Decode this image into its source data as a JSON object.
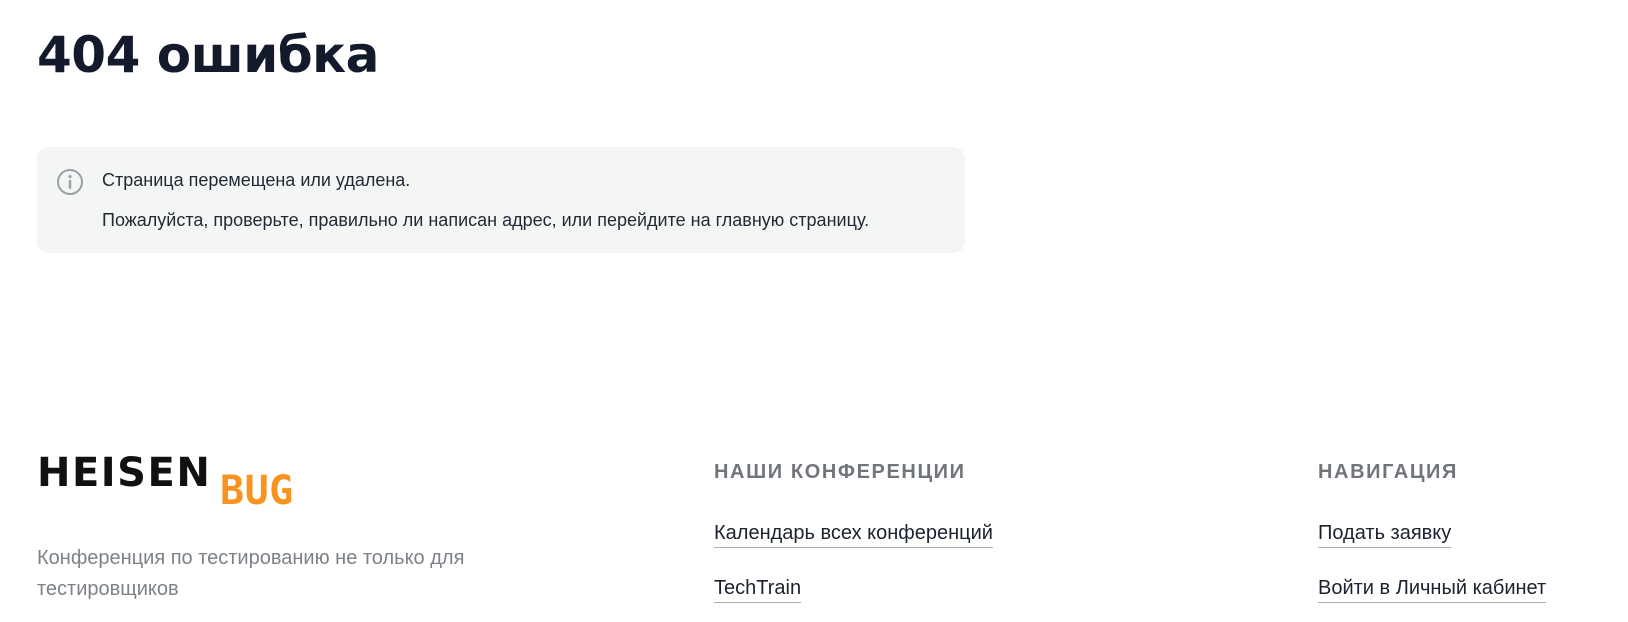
{
  "page": {
    "title": "404 ошибка"
  },
  "notice": {
    "icon": "info-icon",
    "line1": "Страница перемещена или удалена.",
    "line2": "Пожалуйста, проверьте, правильно ли написан адрес, или перейдите на главную страницу."
  },
  "footer": {
    "logo": {
      "text_primary": "HEISEN",
      "text_accent": "BUG",
      "primary_color": "#111111",
      "accent_color": "#f7931e"
    },
    "tagline": "Конференция по тестированию не только для тестировщиков",
    "conferences": {
      "heading": "НАШИ КОНФЕРЕНЦИИ",
      "links": [
        {
          "label": "Календарь всех конференций"
        },
        {
          "label": "TechTrain"
        }
      ]
    },
    "navigation": {
      "heading": "НАВИГАЦИЯ",
      "links": [
        {
          "label": "Подать заявку"
        },
        {
          "label": "Войти в Личный кабинет"
        }
      ]
    }
  }
}
